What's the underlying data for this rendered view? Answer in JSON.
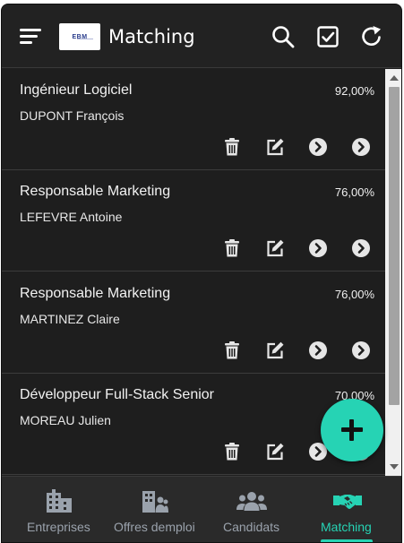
{
  "app": {
    "title": "Matching",
    "logo_text": "EBM"
  },
  "colors": {
    "accent": "#26d3b4",
    "background": "#1e1e1e",
    "topbar": "#222222",
    "nav_inactive": "#9aa2ac"
  },
  "topbar": {
    "icons": [
      "menu-icon",
      "search-icon",
      "checkbox-icon",
      "refresh-icon"
    ]
  },
  "matches": [
    {
      "title": "Ingénieur Logiciel",
      "score": "92,00%",
      "candidate": "DUPONT François"
    },
    {
      "title": "Responsable Marketing",
      "score": "76,00%",
      "candidate": "LEFEVRE Antoine"
    },
    {
      "title": "Responsable Marketing",
      "score": "76,00%",
      "candidate": "MARTINEZ Claire"
    },
    {
      "title": "Développeur Full-Stack Senior",
      "score": "70,00%",
      "candidate": "MOREAU Julien"
    }
  ],
  "card_actions": [
    "trash-icon",
    "edit-icon",
    "chevron-right-circle-icon",
    "chevron-right-circle-icon"
  ],
  "fab": {
    "icon": "plus-icon"
  },
  "bottom_nav": [
    {
      "label": "Entreprises",
      "icon": "building-icon",
      "active": false
    },
    {
      "label": "Offres demploi",
      "icon": "office-people-icon",
      "active": false
    },
    {
      "label": "Candidats",
      "icon": "users-icon",
      "active": false
    },
    {
      "label": "Matching",
      "icon": "handshake-icon",
      "active": true
    }
  ]
}
